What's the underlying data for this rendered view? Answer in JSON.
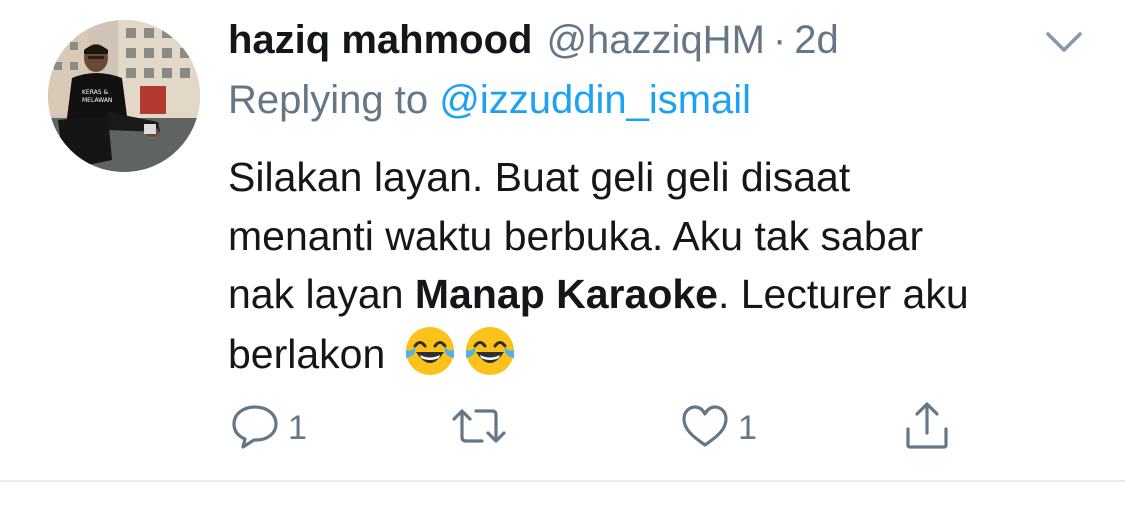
{
  "tweet": {
    "display_name": "haziq mahmood",
    "handle": "@hazziqHM",
    "separator": "·",
    "time": "2d",
    "reply_prefix": "Replying to ",
    "reply_to": "@izzuddin_ismail",
    "text_line1": "Silakan layan. Buat geli geli disaat",
    "text_line2": "menanti waktu berbuka. Aku tak sabar",
    "text_line3_pre": "nak layan ",
    "text_line3_bold": "Manap Karaoke",
    "text_line3_post": ". Lecturer aku",
    "text_line4": "berlakon",
    "avatar_shirt_text": "KERAS & MELAWAN",
    "emojis": [
      "face-with-tears-of-joy",
      "face-with-tears-of-joy"
    ]
  },
  "actions": {
    "reply_count": "1",
    "like_count": "1"
  },
  "colors": {
    "text": "#14171a",
    "muted": "#657786",
    "link": "#1da1f2",
    "divider": "#e6ecf0"
  },
  "icons": [
    "chevron-down-icon",
    "reply-icon",
    "retweet-icon",
    "like-icon",
    "share-icon"
  ]
}
